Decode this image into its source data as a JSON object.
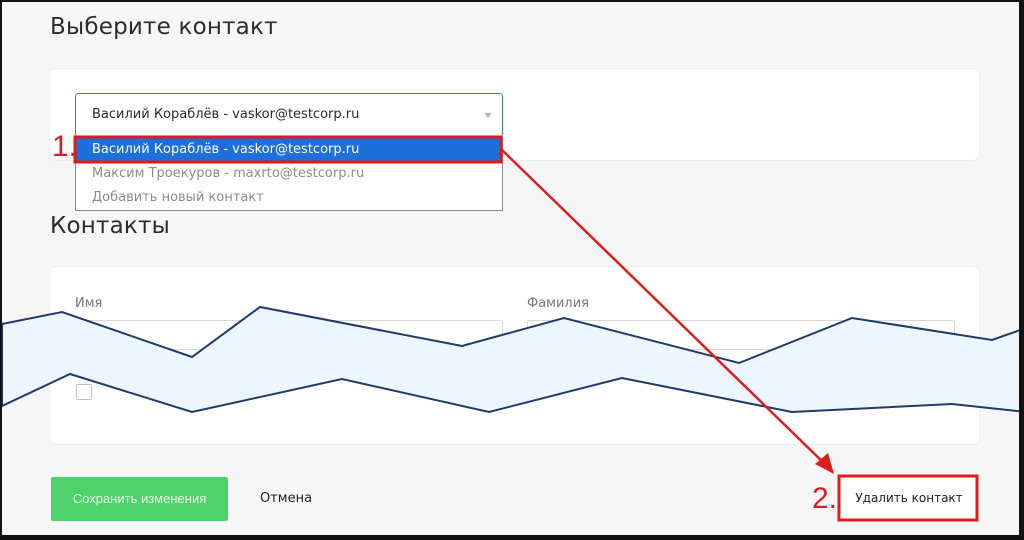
{
  "select_contact": {
    "title": "Выберите контакт",
    "selected_value": "Василий Кораблёв - vaskor@testcorp.ru",
    "options": [
      {
        "label": "Василий Кораблёв - vaskor@testcorp.ru",
        "selected": true
      },
      {
        "label": "Максим Троекуров - maxrto@testcorp.ru",
        "selected": false
      },
      {
        "label": "Добавить новый контакт",
        "selected": false
      }
    ]
  },
  "contacts": {
    "title": "Контакты",
    "first_name_label": "Имя",
    "last_name_label": "Фамилия"
  },
  "actions": {
    "save_label": "Сохранить изменения",
    "cancel_label": "Отмена",
    "delete_label": "Удалить контакт"
  },
  "annotations": {
    "step1": "1.",
    "step2": "2.",
    "color": "#e01b1b"
  },
  "colors": {
    "accent_green": "#4cd36a",
    "select_highlight": "#1e6fd9",
    "tear_fill": "#eef6fd",
    "tear_stroke": "#1f3b6b"
  }
}
